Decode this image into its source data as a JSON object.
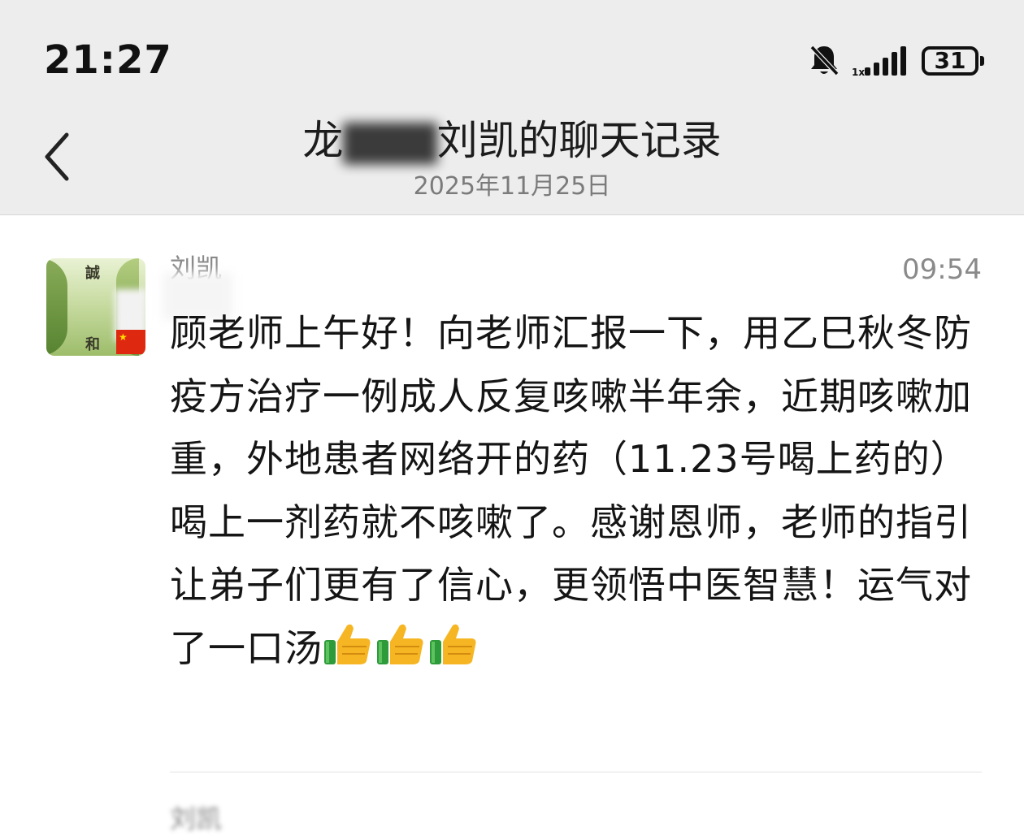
{
  "status_bar": {
    "time": "21:27",
    "mute_icon": "bell-off-icon",
    "signal_icon": "signal-icon",
    "battery": "31"
  },
  "header": {
    "back_icon": "chevron-left-icon",
    "title_prefix": "龙",
    "title_suffix": "刘凯的聊天记录",
    "date": "2025年11月25日"
  },
  "message": {
    "sender": "刘凯",
    "time": "09:54",
    "text": "顾老师上午好！向老师汇报一下，用乙巳秋冬防疫方治疗一例成人反复咳嗽半年余，近期咳嗽加重，外地患者网络开的药（11.23号喝上药的）喝上一剂药就不咳嗽了。感谢恩师，老师的指引让弟子们更有了信心，更领悟中医智慧！运气对了一口汤",
    "emoji": [
      "thumbs-up-icon",
      "thumbs-up-icon",
      "thumbs-up-icon"
    ],
    "avatar_chars": [
      "誠",
      "和"
    ]
  },
  "next_message": {
    "sender": "刘凯"
  }
}
